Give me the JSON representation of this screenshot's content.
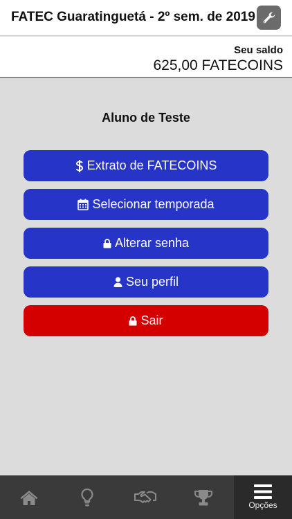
{
  "header": {
    "title": "FATEC Guaratinguetá - 2º sem. de 2019",
    "settings_icon": "wrench-icon"
  },
  "balance": {
    "label": "Seu saldo",
    "value": "625,00 FATECOINS"
  },
  "student": {
    "name": "Aluno de Teste"
  },
  "menu": {
    "statement": {
      "label": "Extrato de FATECOINS",
      "icon": "dollar-icon"
    },
    "season": {
      "label": "Selecionar temporada",
      "icon": "calendar-icon"
    },
    "password": {
      "label": "Alterar senha",
      "icon": "lock-icon"
    },
    "profile": {
      "label": "Seu perfil",
      "icon": "user-icon"
    },
    "logout": {
      "label": "Sair",
      "icon": "lock-icon"
    }
  },
  "tabbar": {
    "home": {
      "icon": "home-icon"
    },
    "ideas": {
      "icon": "lightbulb-icon"
    },
    "deals": {
      "icon": "handshake-icon"
    },
    "ranking": {
      "icon": "trophy-icon"
    },
    "options": {
      "icon": "menu-icon",
      "label": "Opções"
    }
  },
  "colors": {
    "primary_button": "#2634c8",
    "danger_button": "#d40000",
    "tabbar": "#3a3a3a",
    "background": "#dcdcdc"
  }
}
